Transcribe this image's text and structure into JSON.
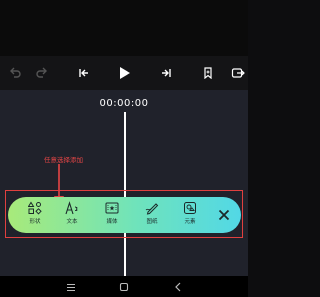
{
  "timecode": "00:00:00",
  "hint": "任意选择添加",
  "toolbar": {
    "items": [
      {
        "label": "形状",
        "icon": "shape-icon"
      },
      {
        "label": "文本",
        "icon": "text-icon"
      },
      {
        "label": "媒体",
        "icon": "media-icon"
      },
      {
        "label": "图纸",
        "icon": "drawing-icon"
      },
      {
        "label": "元素",
        "icon": "element-icon"
      }
    ]
  },
  "colors": {
    "highlight": "#e0403f",
    "toolbar_gradient": [
      "#a8ea7a",
      "#52d8e6"
    ],
    "timeline_bg": "#20222b"
  }
}
